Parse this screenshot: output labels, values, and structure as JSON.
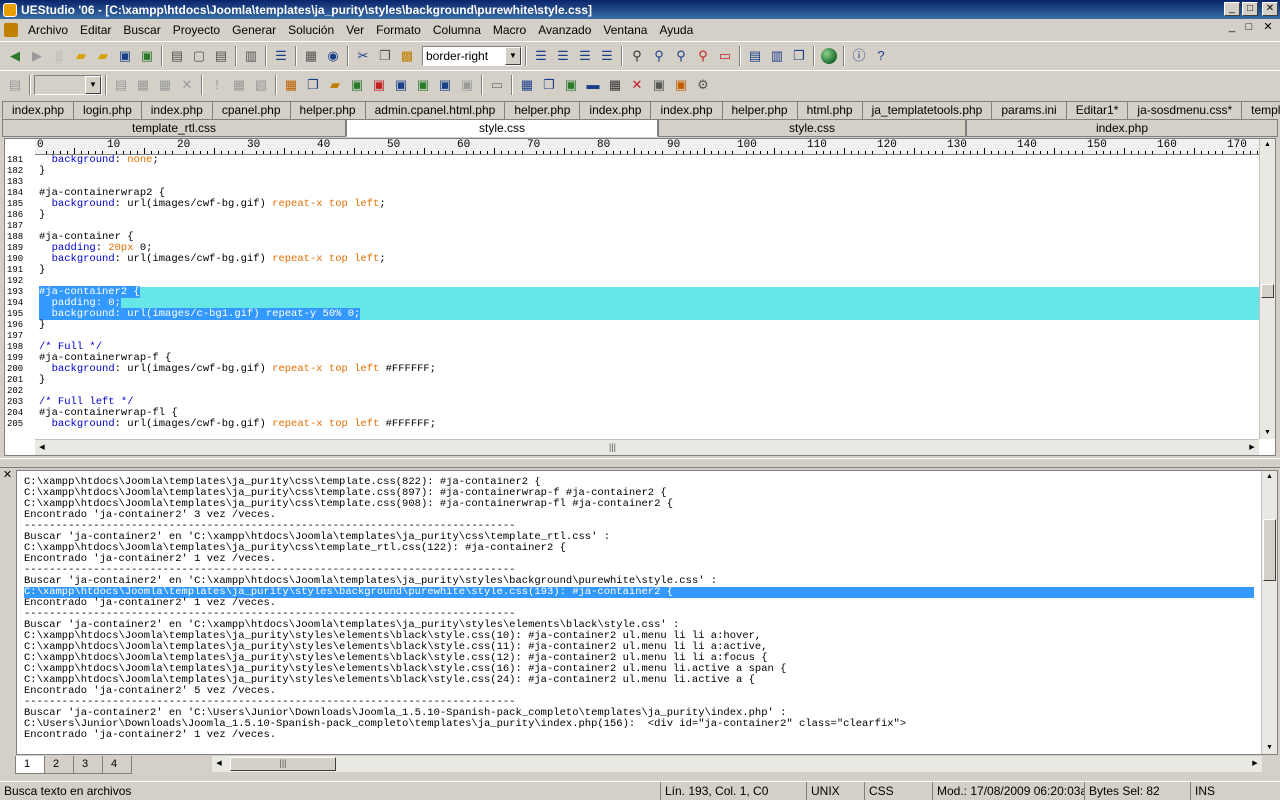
{
  "window": {
    "title": "UEStudio '06 - [C:\\xampp\\htdocs\\Joomla\\templates\\ja_purity\\styles\\background\\purewhite\\style.css]",
    "controls": [
      "_",
      "□",
      "✕"
    ]
  },
  "menu": [
    "Archivo",
    "Editar",
    "Buscar",
    "Proyecto",
    "Generar",
    "Solución",
    "Ver",
    "Formato",
    "Columna",
    "Macro",
    "Avanzado",
    "Ventana",
    "Ayuda"
  ],
  "toolbar": {
    "style_combo_value": "border-right"
  },
  "file_tabs": [
    "index.php",
    "login.php",
    "index.php",
    "cpanel.php",
    "helper.php",
    "admin.cpanel.html.php",
    "helper.php",
    "index.php",
    "index.php",
    "helper.php",
    "html.php",
    "ja_templatetools.php",
    "params.ini",
    "Editar1*",
    "ja-sosdmenu.css*",
    "template.css"
  ],
  "split_tabs": [
    {
      "label": "template_rtl.css",
      "active": false
    },
    {
      "label": "style.css",
      "active": true
    },
    {
      "label": "style.css",
      "active": false
    },
    {
      "label": "index.php",
      "active": false
    }
  ],
  "ruler": {
    "ticks": [
      "0",
      "10",
      "20",
      "30",
      "40",
      "50",
      "60",
      "70",
      "80",
      "90",
      "100",
      "110",
      "120",
      "130",
      "140",
      "150",
      "160",
      "170"
    ]
  },
  "editor": {
    "lines": [
      {
        "n": "181",
        "code": "  background: none;"
      },
      {
        "n": "182",
        "code": "}"
      },
      {
        "n": "183",
        "code": ""
      },
      {
        "n": "184",
        "code": "#ja-containerwrap2 {"
      },
      {
        "n": "185",
        "code": "  background: url(images/cwf-bg.gif) repeat-x top left;"
      },
      {
        "n": "186",
        "code": "}"
      },
      {
        "n": "187",
        "code": ""
      },
      {
        "n": "188",
        "code": "#ja-container {"
      },
      {
        "n": "189",
        "code": "  padding: 20px 0;"
      },
      {
        "n": "190",
        "code": "  background: url(images/cwf-bg.gif) repeat-x top left;"
      },
      {
        "n": "191",
        "code": "}"
      },
      {
        "n": "192",
        "code": ""
      },
      {
        "n": "193",
        "code": "#ja-container2 {",
        "selected": true
      },
      {
        "n": "194",
        "code": "  padding: 0;",
        "selected": true
      },
      {
        "n": "195",
        "code": "  background: url(images/c-bg1.gif) repeat-y 50% 0;",
        "selected": true
      },
      {
        "n": "196",
        "code": "}"
      },
      {
        "n": "197",
        "code": ""
      },
      {
        "n": "198",
        "code": "/* Full */"
      },
      {
        "n": "199",
        "code": "#ja-containerwrap-f {"
      },
      {
        "n": "200",
        "code": "  background: url(images/cwf-bg.gif) repeat-x top left #FFFFFF;"
      },
      {
        "n": "201",
        "code": "}"
      },
      {
        "n": "202",
        "code": ""
      },
      {
        "n": "203",
        "code": "/* Full left */"
      },
      {
        "n": "204",
        "code": "#ja-containerwrap-fl {"
      },
      {
        "n": "205",
        "code": "  background: url(images/cwf-bg.gif) repeat-x top left #FFFFFF;"
      }
    ]
  },
  "output": {
    "lines": [
      "C:\\xampp\\htdocs\\Joomla\\templates\\ja_purity\\css\\template.css(822): #ja-container2 {",
      "C:\\xampp\\htdocs\\Joomla\\templates\\ja_purity\\css\\template.css(897): #ja-containerwrap-f #ja-container2 {",
      "C:\\xampp\\htdocs\\Joomla\\templates\\ja_purity\\css\\template.css(908): #ja-containerwrap-fl #ja-container2 {",
      "Encontrado 'ja-container2' 3 vez /veces.",
      "------------------------------------------------------------------------------",
      "Buscar 'ja-container2' en 'C:\\xampp\\htdocs\\Joomla\\templates\\ja_purity\\css\\template_rtl.css' :",
      "C:\\xampp\\htdocs\\Joomla\\templates\\ja_purity\\css\\template_rtl.css(122): #ja-container2 {",
      "Encontrado 'ja-container2' 1 vez /veces.",
      "------------------------------------------------------------------------------",
      "Buscar 'ja-container2' en 'C:\\xampp\\htdocs\\Joomla\\templates\\ja_purity\\styles\\background\\purewhite\\style.css' :",
      "C:\\xampp\\htdocs\\Joomla\\templates\\ja_purity\\styles\\background\\purewhite\\style.css(193): #ja-container2 {",
      "Encontrado 'ja-container2' 1 vez /veces.",
      "------------------------------------------------------------------------------",
      "Buscar 'ja-container2' en 'C:\\xampp\\htdocs\\Joomla\\templates\\ja_purity\\styles\\elements\\black\\style.css' :",
      "C:\\xampp\\htdocs\\Joomla\\templates\\ja_purity\\styles\\elements\\black\\style.css(10): #ja-container2 ul.menu li li a:hover,",
      "C:\\xampp\\htdocs\\Joomla\\templates\\ja_purity\\styles\\elements\\black\\style.css(11): #ja-container2 ul.menu li li a:active,",
      "C:\\xampp\\htdocs\\Joomla\\templates\\ja_purity\\styles\\elements\\black\\style.css(12): #ja-container2 ul.menu li li a:focus {",
      "C:\\xampp\\htdocs\\Joomla\\templates\\ja_purity\\styles\\elements\\black\\style.css(16): #ja-container2 ul.menu li.active a span {",
      "C:\\xampp\\htdocs\\Joomla\\templates\\ja_purity\\styles\\elements\\black\\style.css(24): #ja-container2 ul.menu li.active a {",
      "Encontrado 'ja-container2' 5 vez /veces.",
      "------------------------------------------------------------------------------",
      "Buscar 'ja-container2' en 'C:\\Users\\Junior\\Downloads\\Joomla_1.5.10-Spanish-pack_completo\\templates\\ja_purity\\index.php' :",
      "C:\\Users\\Junior\\Downloads\\Joomla_1.5.10-Spanish-pack_completo\\templates\\ja_purity\\index.php(156):  <div id=\"ja-container2\" class=\"clearfix\">",
      "Encontrado 'ja-container2' 1 vez /veces."
    ],
    "selected_index": 10,
    "tabs": [
      "1",
      "2",
      "3",
      "4"
    ]
  },
  "status": {
    "message": "Busca texto en archivos",
    "position": "Lín. 193, Col. 1, C0",
    "line_ending": "UNIX",
    "syntax": "CSS",
    "modified": "Mod.: 17/08/2009 06:20:03a.",
    "bytes": "Bytes Sel: 82",
    "insert_mode": "INS"
  },
  "colors": {
    "title_bar": "#0a246a",
    "selection_cyan": "#66e6e6",
    "selection_blue": "#3399ff",
    "css_keyword": "#0000cc",
    "css_value": "#e07000"
  }
}
